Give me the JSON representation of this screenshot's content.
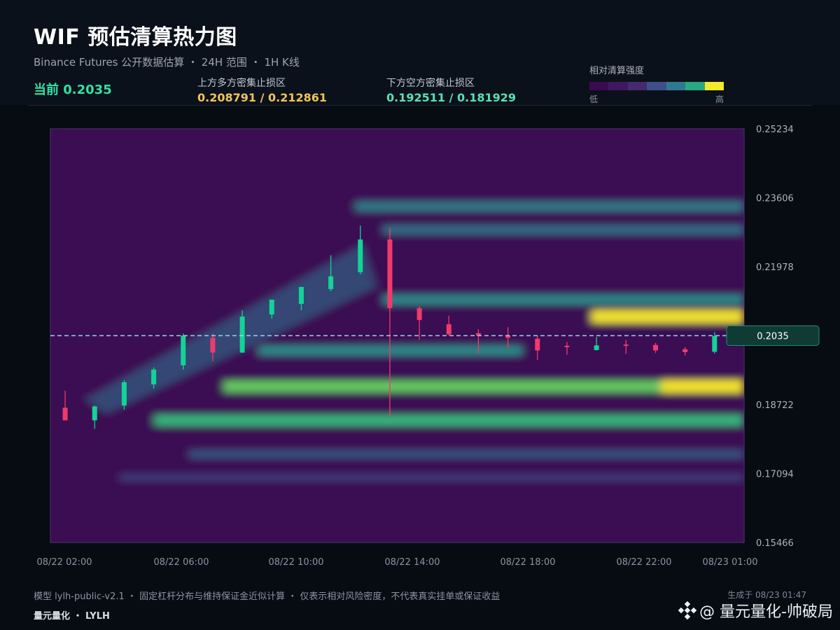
{
  "header": {
    "title": "WIF 预估清算热力图",
    "subtitle": "Binance Futures 公开数据估算 ・ 24H 范围 ・ 1H K线",
    "current_label": "当前 0.2035",
    "upper_zone_label": "上方多方密集止损区",
    "upper_zone_values": "0.208791 / 0.212861",
    "lower_zone_label": "下方空方密集止损区",
    "lower_zone_values": "0.192511 / 0.181929"
  },
  "legend": {
    "title": "相对清算强度",
    "low": "低",
    "high": "高",
    "colors": [
      "#3a0a52",
      "#401860",
      "#442a6e",
      "#3f4f8a",
      "#2f7a90",
      "#2aa882",
      "#f0ea2a"
    ]
  },
  "footer": {
    "note": "模型 lylh-public-v2.1 ・ 固定杠杆分布与维持保证金近似计算 ・ 仅表示相对风险密度，不代表真实挂单或保证收益",
    "brand": "量元量化 ・ LYLH",
    "generated": "生成于 08/23 01:47",
    "watermark": "@ 量元量化-帅破局"
  },
  "chart_data": {
    "type": "heatmap",
    "title": "WIF 预估清算热力图",
    "x_tick_labels": [
      "08/22 02:00",
      "08/22 06:00",
      "08/22 10:00",
      "08/22 14:00",
      "08/22 18:00",
      "08/22 22:00",
      "08/23 01:00"
    ],
    "y_ticks": [
      0.15466,
      0.17094,
      0.18722,
      0.21978,
      0.23606,
      0.25234
    ],
    "ylim": [
      0.15466,
      0.25234
    ],
    "current_price": 0.2035,
    "current_price_label": "0.2035",
    "grid": false,
    "candles": [
      {
        "t": "08/22 02:00",
        "o": 0.1865,
        "h": 0.1905,
        "l": 0.1858,
        "c": 0.1835
      },
      {
        "t": "08/22 03:00",
        "o": 0.1835,
        "h": 0.187,
        "l": 0.1815,
        "c": 0.1868
      },
      {
        "t": "08/22 04:00",
        "o": 0.187,
        "h": 0.193,
        "l": 0.186,
        "c": 0.1925
      },
      {
        "t": "08/22 05:00",
        "o": 0.192,
        "h": 0.196,
        "l": 0.191,
        "c": 0.1955
      },
      {
        "t": "08/22 06:00",
        "o": 0.1965,
        "h": 0.204,
        "l": 0.1955,
        "c": 0.2035
      },
      {
        "t": "08/22 07:00",
        "o": 0.203,
        "h": 0.204,
        "l": 0.1975,
        "c": 0.1995
      },
      {
        "t": "08/22 08:00",
        "o": 0.1995,
        "h": 0.2095,
        "l": 0.1995,
        "c": 0.208
      },
      {
        "t": "08/22 09:00",
        "o": 0.2085,
        "h": 0.212,
        "l": 0.2075,
        "c": 0.212
      },
      {
        "t": "08/22 10:00",
        "o": 0.211,
        "h": 0.215,
        "l": 0.2095,
        "c": 0.215
      },
      {
        "t": "08/22 11:00",
        "o": 0.2145,
        "h": 0.2225,
        "l": 0.214,
        "c": 0.2175
      },
      {
        "t": "08/22 12:00",
        "o": 0.2185,
        "h": 0.2295,
        "l": 0.218,
        "c": 0.2262
      },
      {
        "t": "08/22 13:00",
        "o": 0.2262,
        "h": 0.229,
        "l": 0.1845,
        "c": 0.21
      },
      {
        "t": "08/22 14:00",
        "o": 0.21,
        "h": 0.2105,
        "l": 0.2025,
        "c": 0.2072
      },
      {
        "t": "08/22 15:00",
        "o": 0.2062,
        "h": 0.2082,
        "l": 0.2035,
        "c": 0.2038
      },
      {
        "t": "08/22 16:00",
        "o": 0.2041,
        "h": 0.205,
        "l": 0.1992,
        "c": 0.2035
      },
      {
        "t": "08/22 17:00",
        "o": 0.2036,
        "h": 0.2055,
        "l": 0.2006,
        "c": 0.203
      },
      {
        "t": "08/22 18:00",
        "o": 0.2028,
        "h": 0.2035,
        "l": 0.1978,
        "c": 0.2
      },
      {
        "t": "08/22 19:00",
        "o": 0.2011,
        "h": 0.202,
        "l": 0.199,
        "c": 0.2009
      },
      {
        "t": "08/22 20:00",
        "o": 0.2001,
        "h": 0.2032,
        "l": 0.2,
        "c": 0.2012
      },
      {
        "t": "08/22 21:00",
        "o": 0.2014,
        "h": 0.2025,
        "l": 0.1992,
        "c": 0.2011
      },
      {
        "t": "08/22 22:00",
        "o": 0.2013,
        "h": 0.2018,
        "l": 0.1994,
        "c": 0.2
      },
      {
        "t": "08/22 23:00",
        "o": 0.2003,
        "h": 0.2008,
        "l": 0.1988,
        "c": 0.1996
      },
      {
        "t": "08/23 00:00",
        "o": 0.1997,
        "h": 0.2043,
        "l": 0.1993,
        "c": 0.2034
      }
    ],
    "heat_bands": [
      {
        "price": 0.208,
        "x_start": 0.78,
        "x_end": 1.0,
        "intensity": 1.0
      },
      {
        "price": 0.1915,
        "x_start": 0.88,
        "x_end": 1.0,
        "intensity": 1.0
      },
      {
        "price": 0.1915,
        "x_start": 0.25,
        "x_end": 0.88,
        "intensity": 0.8
      },
      {
        "price": 0.1835,
        "x_start": 0.15,
        "x_end": 1.0,
        "intensity": 0.7
      },
      {
        "price": 0.212,
        "x_start": 0.48,
        "x_end": 1.0,
        "intensity": 0.55
      },
      {
        "price": 0.234,
        "x_start": 0.44,
        "x_end": 1.0,
        "intensity": 0.5
      },
      {
        "price": 0.2285,
        "x_start": 0.48,
        "x_end": 1.0,
        "intensity": 0.45
      },
      {
        "price": 0.2,
        "x_start": 0.3,
        "x_end": 0.68,
        "intensity": 0.55
      },
      {
        "price": 0.1755,
        "x_start": 0.2,
        "x_end": 1.0,
        "intensity": 0.35
      },
      {
        "price": 0.17,
        "x_start": 0.1,
        "x_end": 1.0,
        "intensity": 0.25
      }
    ]
  }
}
